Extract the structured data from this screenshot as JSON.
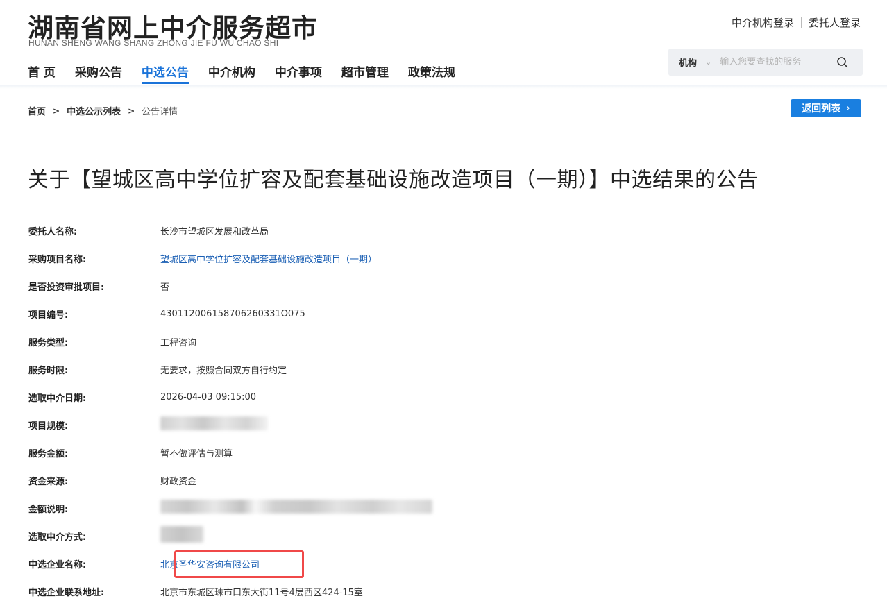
{
  "header": {
    "title": "湖南省网上中介服务超市",
    "subtitle": "HUNAN SHENG WANG SHANG ZHONG JIE FU WU CHAO SHI",
    "login_agency": "中介机构登录",
    "login_client": "委托人登录"
  },
  "nav": {
    "items": [
      {
        "label": "首 页"
      },
      {
        "label": "采购公告"
      },
      {
        "label": "中选公告",
        "active": true
      },
      {
        "label": "中介机构"
      },
      {
        "label": "中介事项"
      },
      {
        "label": "超市管理"
      },
      {
        "label": "政策法规"
      }
    ]
  },
  "search": {
    "type": "机构",
    "placeholder": "输入您要查找的服务",
    "value": ""
  },
  "breadcrumb": {
    "items": [
      "首页",
      "中选公示列表",
      "公告详情"
    ],
    "separator": ">"
  },
  "back_button": {
    "label": "返回列表",
    "icon": "chevron-right-icon"
  },
  "page_title": "关于【望城区高中学位扩容及配套基础设施改造项目（一期）】中选结果的公告",
  "details": [
    {
      "label": "委托人名称:",
      "value": "长沙市望城区发展和改革局"
    },
    {
      "label": "采购项目名称:",
      "value": "望城区高中学位扩容及配套基础设施改造项目（一期）",
      "link": true
    },
    {
      "label": "是否投资审批项目:",
      "value": "否"
    },
    {
      "label": "项目编号:",
      "value": "430112006158706260331O075"
    },
    {
      "label": "服务类型:",
      "value": "工程咨询"
    },
    {
      "label": "服务时限:",
      "value": "无要求，按照合同双方自行约定"
    },
    {
      "label": "选取中介日期:",
      "value": "2026-04-03 09:15:00"
    },
    {
      "label": "项目规模:",
      "value": "",
      "redacted": true
    },
    {
      "label": "服务金额:",
      "value": "暂不做评估与测算"
    },
    {
      "label": "资金来源:",
      "value": "财政资金"
    },
    {
      "label": "金额说明:",
      "value": "",
      "redacted": true
    },
    {
      "label": "选取中介方式:",
      "value": "",
      "redacted": true
    },
    {
      "label": "中选企业名称:",
      "value": "北京圣华安咨询有限公司",
      "link": true,
      "highlighted": true
    },
    {
      "label": "中选企业联系地址:",
      "value": "北京市东城区珠市口东大街11号4层西区424-15室"
    }
  ],
  "colors": {
    "accent": "#1a73d9",
    "button": "#1a7fe0",
    "link": "#1a5fb4",
    "highlight_border": "#f04848"
  }
}
